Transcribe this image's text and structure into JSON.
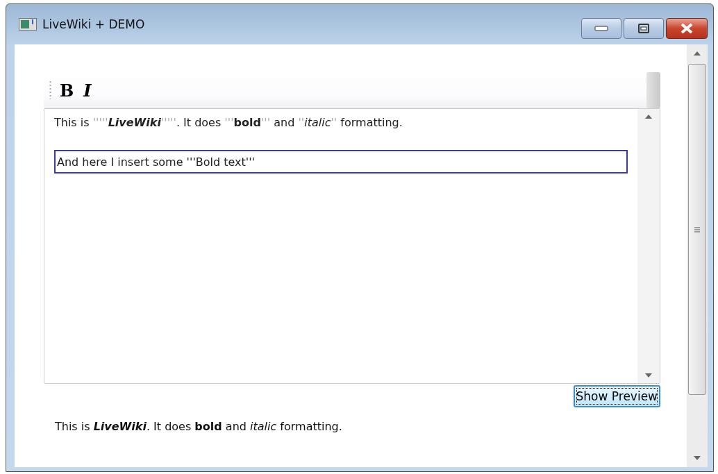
{
  "window": {
    "title": "LiveWiki + DEMO"
  },
  "toolbar": {
    "buttons": [
      {
        "label": "B",
        "kind": "bold"
      },
      {
        "label": "I",
        "kind": "italic"
      }
    ]
  },
  "editor": {
    "line": [
      {
        "text": "This is ",
        "kind": "plain"
      },
      {
        "text": "'''''",
        "kind": "markup"
      },
      {
        "text": "LiveWiki",
        "kind": "bolditalic"
      },
      {
        "text": "'''''",
        "kind": "markup"
      },
      {
        "text": ". It does ",
        "kind": "plain"
      },
      {
        "text": "'''",
        "kind": "markup"
      },
      {
        "text": "bold",
        "kind": "bold"
      },
      {
        "text": "'''",
        "kind": "markup"
      },
      {
        "text": " and ",
        "kind": "plain"
      },
      {
        "text": "''",
        "kind": "markup"
      },
      {
        "text": "italic",
        "kind": "italic"
      },
      {
        "text": "''",
        "kind": "markup"
      },
      {
        "text": " formatting.",
        "kind": "plain"
      }
    ],
    "input": {
      "value": "And here I insert some '''Bold text'''"
    }
  },
  "preview_button": {
    "label": "Show Preview"
  },
  "preview": [
    {
      "text": "This is ",
      "kind": "plain"
    },
    {
      "text": "LiveWiki",
      "kind": "bolditalic"
    },
    {
      "text": ". It does ",
      "kind": "plain"
    },
    {
      "text": "bold",
      "kind": "bold"
    },
    {
      "text": " and ",
      "kind": "plain"
    },
    {
      "text": "italic",
      "kind": "italic"
    },
    {
      "text": " formatting.",
      "kind": "plain"
    }
  ]
}
